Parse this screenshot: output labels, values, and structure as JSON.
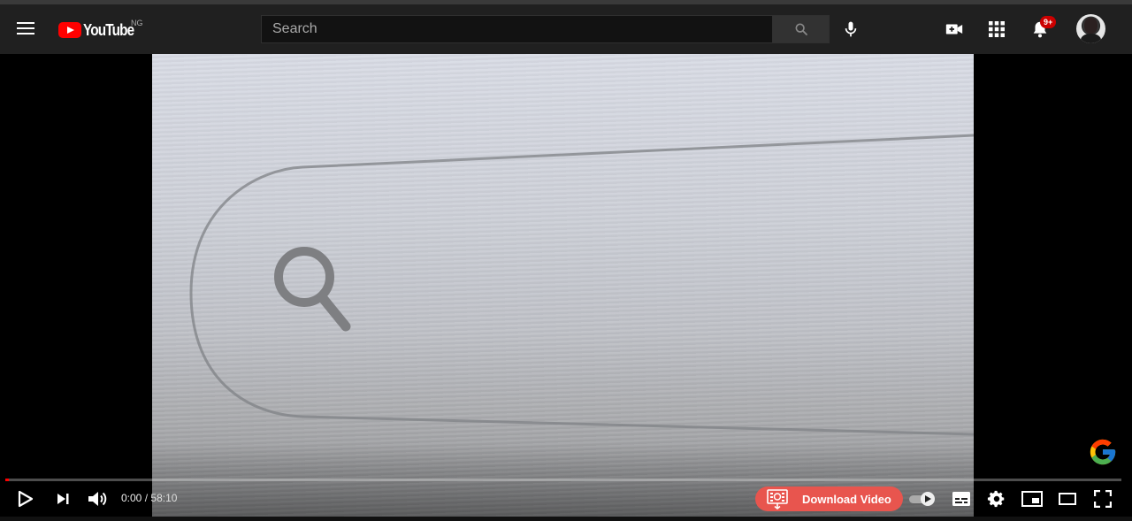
{
  "header": {
    "logo_text": "YouTube",
    "country_code": "NG",
    "search_placeholder": "Search",
    "notification_badge": "9+",
    "icons": [
      "menu-icon",
      "search-icon",
      "microphone-icon",
      "create-video-icon",
      "apps-grid-icon",
      "bell-icon",
      "avatar"
    ]
  },
  "player": {
    "current_time": "0:00",
    "separator": "/",
    "duration": "58:10",
    "progress_fraction": 0,
    "download_label": "Download Video",
    "autoplay_on": true,
    "colors": {
      "progress_played": "#ff0000",
      "download_button": "#e8554e",
      "badge": "#cc0000"
    },
    "controls": [
      "play-icon",
      "next-icon",
      "volume-icon",
      "autoplay-toggle",
      "subtitles-icon",
      "settings-icon",
      "miniplayer-icon",
      "theater-icon",
      "fullscreen-icon"
    ]
  }
}
